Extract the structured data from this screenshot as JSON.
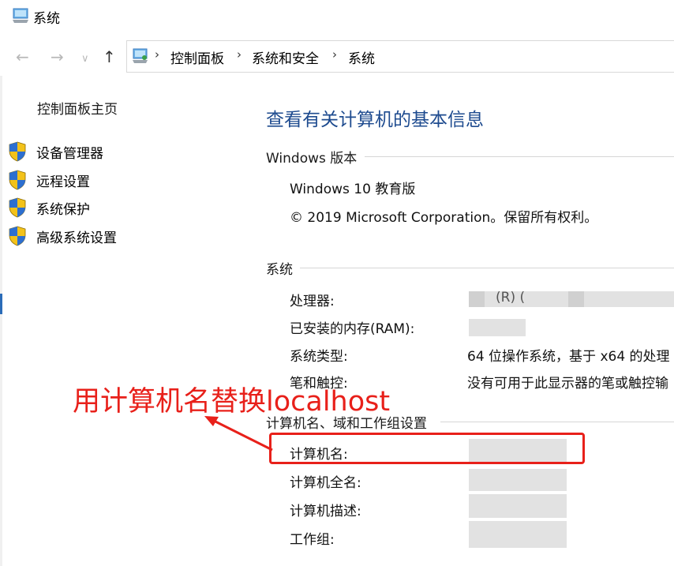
{
  "window": {
    "title": "系统"
  },
  "nav": {
    "back_icon": "back-arrow-icon",
    "forward_icon": "forward-arrow-icon",
    "recent_icon": "chevron-down-icon",
    "up_icon": "up-arrow-icon"
  },
  "breadcrumb": {
    "items": [
      "控制面板",
      "系统和安全",
      "系统"
    ],
    "separator": "›"
  },
  "sidebar": {
    "home": "控制面板主页",
    "items": [
      {
        "label": "设备管理器",
        "icon": "shield-icon"
      },
      {
        "label": "远程设置",
        "icon": "shield-icon"
      },
      {
        "label": "系统保护",
        "icon": "shield-icon"
      },
      {
        "label": "高级系统设置",
        "icon": "shield-icon"
      }
    ]
  },
  "main": {
    "title": "查看有关计算机的基本信息",
    "windows_edition": {
      "heading": "Windows 版本",
      "edition": "Windows 10 教育版",
      "copyright": "© 2019 Microsoft Corporation。保留所有权利。"
    },
    "system": {
      "heading": "系统",
      "processor_label": "处理器:",
      "processor_value": "(R) (",
      "ram_label": "已安装的内存(RAM):",
      "type_label": "系统类型:",
      "type_value": "64 位操作系统，基于 x64 的处理",
      "pen_label": "笔和触控:",
      "pen_value": "没有可用于此显示器的笔或触控输"
    },
    "computer": {
      "heading": "计算机名、域和工作组设置",
      "name_label": "计算机名:",
      "fullname_label": "计算机全名:",
      "description_label": "计算机描述:",
      "workgroup_label": "工作组:"
    }
  },
  "annotation": {
    "text": "用计算机名替换localhost",
    "color": "#e8201a"
  },
  "colors": {
    "title_blue": "#1e4b8f",
    "annotation_red": "#e8201a"
  }
}
